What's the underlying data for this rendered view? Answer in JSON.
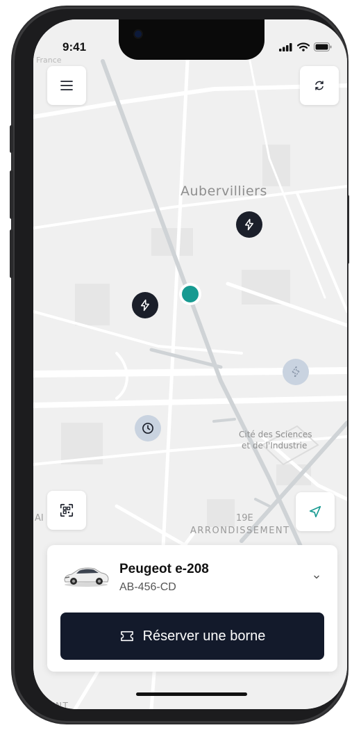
{
  "status_bar": {
    "time": "9:41"
  },
  "map": {
    "corner_label": "France",
    "city_label": "Aubervilliers",
    "poi_label_line1": "Cité des Sciences",
    "poi_label_line2": "et de l'Industrie",
    "district_number": "19E",
    "district_label": "ARRONDISSEMENT",
    "bottom_label_1": "E",
    "bottom_label_2": "EMENT",
    "left_label": "AI"
  },
  "controls": {
    "menu_icon": "hamburger-icon",
    "sync_icon": "refresh-icon",
    "scan_icon": "qr-scan-icon",
    "locate_icon": "navigation-arrow-icon"
  },
  "vehicle": {
    "name": "Peugeot e-208",
    "plate": "AB-456-CD"
  },
  "reserve_button": {
    "label": "Réserver une borne",
    "icon": "ticket-icon"
  },
  "colors": {
    "accent_teal": "#179a91",
    "button_dark": "#131a2b",
    "pin_dark": "#1b1f2a",
    "pin_light": "#c9d3e0"
  }
}
